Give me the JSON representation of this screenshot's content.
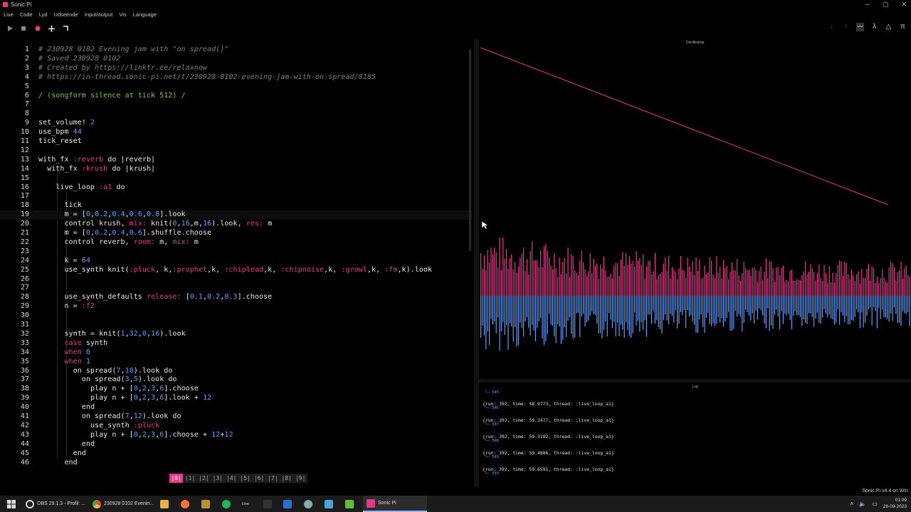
{
  "window": {
    "title": "Sonic Pi"
  },
  "menu": [
    "Live",
    "Code",
    "Lyd",
    "Udseende",
    "Input/output",
    "Vis",
    "Language"
  ],
  "toolbar_icons": [
    "play-icon",
    "stop-icon",
    "record-icon",
    "plus-icon",
    "corner-icon"
  ],
  "right_icons": [
    "arrow-down-icon",
    "arrow-up-icon",
    "scope-icon",
    "lambda-icon",
    "triangle-icon",
    "pi-icon"
  ],
  "scope": {
    "title": "Oscilloskop"
  },
  "editor": {
    "active_line": 19,
    "lines": [
      {
        "n": "1",
        "indent": 0,
        "tokens": [
          [
            "c",
            "# 230928 0102 Evening jam with \"on spread()\""
          ]
        ]
      },
      {
        "n": "2",
        "indent": 0,
        "tokens": [
          [
            "c",
            "# Saved 230928 0102"
          ]
        ]
      },
      {
        "n": "3",
        "indent": 0,
        "tokens": [
          [
            "c",
            "# Created by https://linktr.ee/relaxnow"
          ]
        ]
      },
      {
        "n": "4",
        "indent": 0,
        "tokens": [
          [
            "c",
            "# https://in-thread.sonic-pi.net/t/230928-0102-evening-jam-with-on-spread/8185"
          ]
        ]
      },
      {
        "n": "5",
        "indent": 0,
        "tokens": []
      },
      {
        "n": "6",
        "indent": 0,
        "tokens": [
          [
            "grn",
            "/ (songform silence at tick 512) /"
          ]
        ]
      },
      {
        "n": "7",
        "indent": 0,
        "tokens": []
      },
      {
        "n": "8",
        "indent": 0,
        "tokens": []
      },
      {
        "n": "9",
        "indent": 0,
        "tokens": [
          [
            "k",
            "set_volume! "
          ],
          [
            "num",
            "2"
          ]
        ]
      },
      {
        "n": "10",
        "indent": 0,
        "tokens": [
          [
            "k",
            "use_bpm "
          ],
          [
            "num",
            "44"
          ]
        ]
      },
      {
        "n": "11",
        "indent": 0,
        "tokens": [
          [
            "k",
            "tick_reset"
          ]
        ]
      },
      {
        "n": "12",
        "indent": 0,
        "tokens": []
      },
      {
        "n": "13",
        "indent": 0,
        "tokens": [
          [
            "k",
            "with_fx "
          ],
          [
            "sym",
            ":reverb"
          ],
          [
            "k",
            " do |reverb|"
          ]
        ]
      },
      {
        "n": "14",
        "indent": 2,
        "tokens": [
          [
            "k",
            "with_fx "
          ],
          [
            "sym",
            ":krush"
          ],
          [
            "k",
            " do |krush|"
          ]
        ]
      },
      {
        "n": "15",
        "indent": 0,
        "tokens": []
      },
      {
        "n": "16",
        "indent": 4,
        "tokens": [
          [
            "k",
            "live_loop "
          ],
          [
            "sym",
            ":a1"
          ],
          [
            "k",
            " do"
          ]
        ]
      },
      {
        "n": "17",
        "indent": 0,
        "tokens": []
      },
      {
        "n": "18",
        "indent": 6,
        "tokens": [
          [
            "k",
            "tick"
          ]
        ]
      },
      {
        "n": "19",
        "indent": 6,
        "tokens": [
          [
            "k",
            "m = ["
          ],
          [
            "num",
            "0"
          ],
          [
            "k",
            ","
          ],
          [
            "num",
            "0.2"
          ],
          [
            "k",
            ","
          ],
          [
            "num",
            "0.4"
          ],
          [
            "k",
            ","
          ],
          [
            "num",
            "0.6"
          ],
          [
            "k",
            ","
          ],
          [
            "num",
            "0.8"
          ],
          [
            "k",
            "].look"
          ]
        ]
      },
      {
        "n": "20",
        "indent": 6,
        "tokens": [
          [
            "k",
            "control krush, "
          ],
          [
            "sym",
            "mix:"
          ],
          [
            "k",
            " knit("
          ],
          [
            "num",
            "0"
          ],
          [
            "k",
            ","
          ],
          [
            "num",
            "16"
          ],
          [
            "k",
            ",m,"
          ],
          [
            "num",
            "16"
          ],
          [
            "k",
            ").look, "
          ],
          [
            "sym",
            "res:"
          ],
          [
            "k",
            " m"
          ]
        ]
      },
      {
        "n": "21",
        "indent": 6,
        "tokens": [
          [
            "k",
            "m = ["
          ],
          [
            "num",
            "0"
          ],
          [
            "k",
            ","
          ],
          [
            "num",
            "0.2"
          ],
          [
            "k",
            ","
          ],
          [
            "num",
            "0.4"
          ],
          [
            "k",
            ","
          ],
          [
            "num",
            "0.6"
          ],
          [
            "k",
            "].shuffle.choose"
          ]
        ]
      },
      {
        "n": "22",
        "indent": 6,
        "tokens": [
          [
            "k",
            "control reverb, "
          ],
          [
            "sym",
            "room:"
          ],
          [
            "k",
            " m, "
          ],
          [
            "sym",
            "mix:"
          ],
          [
            "k",
            " m"
          ]
        ]
      },
      {
        "n": "23",
        "indent": 0,
        "tokens": []
      },
      {
        "n": "24",
        "indent": 6,
        "tokens": [
          [
            "k",
            "k = "
          ],
          [
            "num",
            "64"
          ]
        ]
      },
      {
        "n": "25",
        "indent": 6,
        "tokens": [
          [
            "k",
            "use_synth knit("
          ],
          [
            "sym",
            ":pluck"
          ],
          [
            "k",
            ", k,"
          ],
          [
            "sym",
            ":prophet"
          ],
          [
            "k",
            ",k, "
          ],
          [
            "sym",
            ":chiplead"
          ],
          [
            "k",
            ",k, "
          ],
          [
            "sym",
            ":chipnoise"
          ],
          [
            "k",
            ",k, "
          ],
          [
            "sym",
            ":growl"
          ],
          [
            "k",
            ",k, "
          ],
          [
            "sym",
            ":fm"
          ],
          [
            "k",
            ",k).look"
          ]
        ]
      },
      {
        "n": "26",
        "indent": 0,
        "tokens": []
      },
      {
        "n": "27",
        "indent": 0,
        "tokens": []
      },
      {
        "n": "28",
        "indent": 6,
        "tokens": [
          [
            "k",
            "use_synth_defaults "
          ],
          [
            "sym",
            "release:"
          ],
          [
            "k",
            " ["
          ],
          [
            "num",
            "0.1"
          ],
          [
            "k",
            ","
          ],
          [
            "num",
            "0.2"
          ],
          [
            "k",
            ","
          ],
          [
            "num",
            "0.3"
          ],
          [
            "k",
            "].choose"
          ]
        ]
      },
      {
        "n": "29",
        "indent": 6,
        "tokens": [
          [
            "k",
            "n = "
          ],
          [
            "sym",
            ":f2"
          ]
        ]
      },
      {
        "n": "30",
        "indent": 0,
        "tokens": []
      },
      {
        "n": "31",
        "indent": 0,
        "tokens": []
      },
      {
        "n": "32",
        "indent": 6,
        "tokens": [
          [
            "k",
            "synth = knit("
          ],
          [
            "num",
            "1"
          ],
          [
            "k",
            ","
          ],
          [
            "num",
            "32"
          ],
          [
            "k",
            ","
          ],
          [
            "num",
            "0"
          ],
          [
            "k",
            ","
          ],
          [
            "num",
            "16"
          ],
          [
            "k",
            ").look"
          ]
        ]
      },
      {
        "n": "33",
        "indent": 6,
        "tokens": [
          [
            "sym",
            "case"
          ],
          [
            "k",
            " synth"
          ]
        ]
      },
      {
        "n": "34",
        "indent": 6,
        "tokens": [
          [
            "sym",
            "when"
          ],
          [
            "k",
            " "
          ],
          [
            "num",
            "0"
          ]
        ]
      },
      {
        "n": "35",
        "indent": 6,
        "tokens": [
          [
            "sym",
            "when"
          ],
          [
            "k",
            " "
          ],
          [
            "num",
            "1"
          ]
        ]
      },
      {
        "n": "36",
        "indent": 8,
        "tokens": [
          [
            "k",
            "on spread("
          ],
          [
            "num",
            "7"
          ],
          [
            "k",
            ","
          ],
          [
            "num",
            "10"
          ],
          [
            "k",
            ").look do"
          ]
        ]
      },
      {
        "n": "37",
        "indent": 10,
        "tokens": [
          [
            "k",
            "on spread("
          ],
          [
            "num",
            "3"
          ],
          [
            "k",
            ","
          ],
          [
            "num",
            "5"
          ],
          [
            "k",
            ").look do"
          ]
        ]
      },
      {
        "n": "38",
        "indent": 12,
        "tokens": [
          [
            "k",
            "play n + ["
          ],
          [
            "num",
            "0"
          ],
          [
            "k",
            ","
          ],
          [
            "num",
            "2"
          ],
          [
            "k",
            ","
          ],
          [
            "num",
            "3"
          ],
          [
            "k",
            ","
          ],
          [
            "num",
            "6"
          ],
          [
            "k",
            "].choose"
          ]
        ]
      },
      {
        "n": "39",
        "indent": 12,
        "tokens": [
          [
            "k",
            "play n + ["
          ],
          [
            "num",
            "0"
          ],
          [
            "k",
            ","
          ],
          [
            "num",
            "2"
          ],
          [
            "k",
            ","
          ],
          [
            "num",
            "3"
          ],
          [
            "k",
            ","
          ],
          [
            "num",
            "6"
          ],
          [
            "k",
            "].look + "
          ],
          [
            "num",
            "12"
          ]
        ]
      },
      {
        "n": "40",
        "indent": 10,
        "tokens": [
          [
            "k",
            "end"
          ]
        ]
      },
      {
        "n": "41",
        "indent": 10,
        "tokens": [
          [
            "k",
            "on spread("
          ],
          [
            "num",
            "7"
          ],
          [
            "k",
            ","
          ],
          [
            "num",
            "12"
          ],
          [
            "k",
            ").look do"
          ]
        ]
      },
      {
        "n": "42",
        "indent": 12,
        "tokens": [
          [
            "k",
            "use_synth "
          ],
          [
            "sym",
            ":pluck"
          ]
        ]
      },
      {
        "n": "43",
        "indent": 12,
        "tokens": [
          [
            "k",
            "play n + ["
          ],
          [
            "num",
            "0"
          ],
          [
            "k",
            ","
          ],
          [
            "num",
            "2"
          ],
          [
            "k",
            ","
          ],
          [
            "num",
            "3"
          ],
          [
            "k",
            ","
          ],
          [
            "num",
            "6"
          ],
          [
            "k",
            "].choose + "
          ],
          [
            "num",
            "12"
          ],
          [
            "k",
            "+"
          ],
          [
            "num",
            "12"
          ]
        ]
      },
      {
        "n": "44",
        "indent": 10,
        "tokens": [
          [
            "k",
            "end"
          ]
        ]
      },
      {
        "n": "45",
        "indent": 8,
        "tokens": [
          [
            "k",
            "end"
          ]
        ]
      },
      {
        "n": "46",
        "indent": 6,
        "tokens": [
          [
            "k",
            "end"
          ]
        ]
      }
    ]
  },
  "buffers": [
    "|0|",
    "|1|",
    "|2|",
    "|3|",
    "|4|",
    "|5|",
    "|6|",
    "|7|",
    "|8|",
    "|9|"
  ],
  "active_buffer": 0,
  "log": {
    "title": "Log",
    "first_sub": "└─ 345",
    "entries": [
      {
        "line": "{run: 392, time: 58.9773, thread: :live_loop_a1}",
        "sub": "└─ 346"
      },
      {
        "line": "{run: 392, time: 59.1477, thread: :live_loop_a1}",
        "sub": "└─ 347"
      },
      {
        "line": "{run: 392, time: 59.3182, thread: :live_loop_a1}",
        "sub": "└─ 348"
      },
      {
        "line": "{run: 392, time: 59.4886, thread: :live_loop_a1}",
        "sub": "└─ 349"
      },
      {
        "line": "{run: 392, time: 59.6591, thread: :live_loop_a1}",
        "sub": "└─ 350"
      }
    ]
  },
  "version": "Sonic Pi v4.4 on Win",
  "taskbar": {
    "obs": "OBS 29.1.3 - Profil: ...",
    "chrome": "230928 0102 Evenin...",
    "live": "Live",
    "sonic": "Sonic Pi",
    "time": "01:09",
    "date": "28-09-2023"
  },
  "colors": {
    "accent": "#e8378a",
    "blue": "#5aa0ff",
    "green": "#7ec64e"
  }
}
